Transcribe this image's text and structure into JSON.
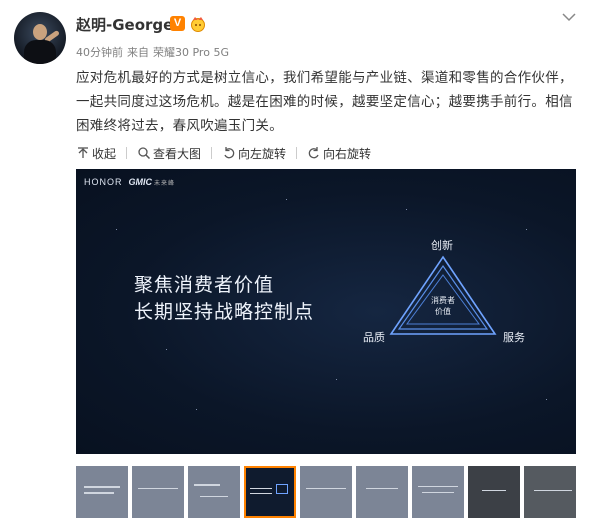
{
  "user": {
    "name": "赵明-George",
    "verified_badge": "V",
    "avatar_icon": "avatar"
  },
  "meta": {
    "time": "40分钟前",
    "source_prefix": "来自",
    "device": "荣耀30 Pro 5G"
  },
  "post": {
    "text": "应对危机最好的方式是树立信心，我们希望能与产业链、渠道和零售的合作伙伴，一起共同度过这场危机。越是在困难的时候，越要坚定信心；越要携手前行。相信困难终将过去，春风吹遍玉门关。"
  },
  "toolbar": {
    "collapse": "收起",
    "view_large": "查看大图",
    "rotate_left": "向左旋转",
    "rotate_right": "向右旋转"
  },
  "slide": {
    "brand": "HONOR",
    "brand2": "GMIC",
    "brand2_sub": "未来峰",
    "line1": "聚焦消费者价值",
    "line2": "长期坚持战略控制点",
    "triangle": {
      "top": "创新",
      "left": "品质",
      "right": "服务",
      "center_line1": "消费者",
      "center_line2": "价值"
    }
  },
  "thumbnails": {
    "count": 10,
    "selected_index": 3
  },
  "colors": {
    "accent": "#ff8200",
    "slide_bg": "#0b1628",
    "text": "#333333",
    "meta": "#808080"
  }
}
